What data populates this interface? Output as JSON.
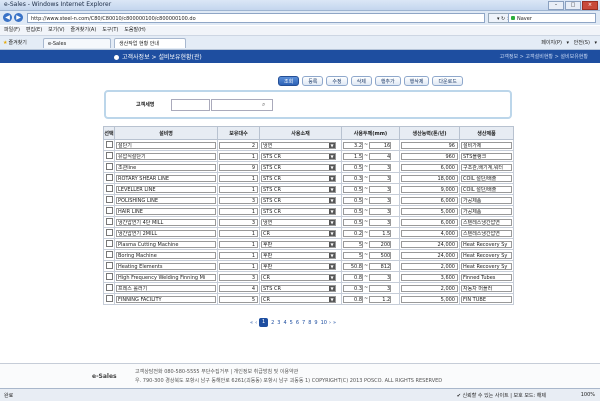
{
  "browser": {
    "title": "e-Sales - Windows Internet Explorer",
    "address": "http://www.steel-n.com/C80/C80010/c800000100/c800000100.do",
    "search_placeholder": "Naver",
    "menu": [
      "파일(F)",
      "편집(E)",
      "보기(V)",
      "즐겨찾기(A)",
      "도구(T)",
      "도움말(H)"
    ],
    "favorites": "즐겨찾기",
    "tabs": [
      "e-Sales",
      "생산작업 현황 안내"
    ],
    "tools": "페이지(P) ▾   안전(S) ▾"
  },
  "page": {
    "title": "고객사정보 > 설비보유현황(관)",
    "breadcrumb": "고객정보 > 고객설비현황 > 설비보유현황"
  },
  "toolbar": {
    "buttons": [
      "조회",
      "등록",
      "수정",
      "삭제",
      "행추가",
      "행삭제",
      "다운로드"
    ]
  },
  "search": {
    "label": "고객세명"
  },
  "table": {
    "headers": [
      "선택",
      "설비명",
      "보유대수",
      "사용소재",
      "사용두께(mm)",
      "생산능력(톤/년)",
      "생산제품"
    ],
    "rows": [
      {
        "name": "절단기",
        "qty": "2",
        "material": "냉연",
        "t1": "3.2",
        "t2": "16",
        "cap": "96",
        "product": "설비가제"
      },
      {
        "name": "유압식절단기",
        "qty": "1",
        "material": "STS CR",
        "t1": "1.5",
        "t2": "4",
        "cap": "960",
        "product": "STS블랭크"
      },
      {
        "name": "조관line",
        "qty": "9",
        "material": "STS CR",
        "t1": "0.5",
        "t2": "3",
        "cap": "6,000",
        "product": "구조관,배기계,워터"
      },
      {
        "name": "ROTARY SHEAR LINE",
        "qty": "1",
        "material": "STS CR",
        "t1": "0.3",
        "t2": "3",
        "cap": "18,000",
        "product": "COIL 절단/배출"
      },
      {
        "name": "LEVELLER LINE",
        "qty": "1",
        "material": "STS CR",
        "t1": "0.5",
        "t2": "3",
        "cap": "9,000",
        "product": "COIL 절단/배출"
      },
      {
        "name": "POLISHING LINE",
        "qty": "3",
        "material": "STS CR",
        "t1": "0.5",
        "t2": "3",
        "cap": "6,000",
        "product": "가공제품"
      },
      {
        "name": "HAIR LINE",
        "qty": "1",
        "material": "STS CR",
        "t1": "0.5",
        "t2": "3",
        "cap": "5,000",
        "product": "가공제품"
      },
      {
        "name": "냉간압연기 4단 MILL",
        "qty": "3",
        "material": "냉연",
        "t1": "0.5",
        "t2": "3",
        "cap": "6,000",
        "product": "스텐레스냉간압연"
      },
      {
        "name": "냉간압연기 2MILL",
        "qty": "1",
        "material": "CR",
        "t1": "0.2",
        "t2": "1.5",
        "cap": "4,000",
        "product": "스텐레스냉간압연"
      },
      {
        "name": "Plasma Cutting Machine",
        "qty": "1",
        "material": "후판",
        "t1": "5",
        "t2": "200",
        "cap": "24,000",
        "product": "Heat Recovery Sy"
      },
      {
        "name": "Boring Machine",
        "qty": "1",
        "material": "후판",
        "t1": "5",
        "t2": "500",
        "cap": "24,000",
        "product": "Heat Recovery Sy"
      },
      {
        "name": "Heating Elements",
        "qty": "1",
        "material": "후판",
        "t1": "50.8",
        "t2": "812",
        "cap": "2,000",
        "product": "Heat Recovery Sy"
      },
      {
        "name": "High Frequency Welding Finning Mi",
        "qty": "3",
        "material": "CR",
        "t1": "0.8",
        "t2": "3",
        "cap": "3,600",
        "product": "Finned Tubes"
      },
      {
        "name": "프레스 롤러기",
        "qty": "4",
        "material": "STS CR",
        "t1": "0.3",
        "t2": "3",
        "cap": "2,000",
        "product": "자동차 머플러"
      },
      {
        "name": "FINNING FACILITY",
        "qty": "5",
        "material": "CR",
        "t1": "0.8",
        "t2": "1.2",
        "cap": "5,000",
        "product": "FIN TUBE"
      }
    ]
  },
  "pager": {
    "prev": "«",
    "prev1": "‹",
    "pages": [
      "1",
      "2",
      "3",
      "4",
      "5",
      "6",
      "7",
      "8",
      "9",
      "10"
    ],
    "current": "1",
    "next1": "›",
    "next": "»"
  },
  "footer": {
    "logo": "e-Sales",
    "line1": "고객상담전화 080-580-5555   무단수집거부 | 개인정보 취급방침 및 이용약관",
    "line2": "우. 790-300 경상북도 포항시 남구 동해안로 6261(괴동동) 포항시 남구 괴동동 1)   COPYRIGHT(C) 2013 POSCO. ALL RIGHTS RESERVED"
  },
  "status": {
    "left": "완료",
    "zone": "✔ 신뢰할 수 있는 사이트 | 보호 모드: 해제",
    "zoom": "100%"
  }
}
